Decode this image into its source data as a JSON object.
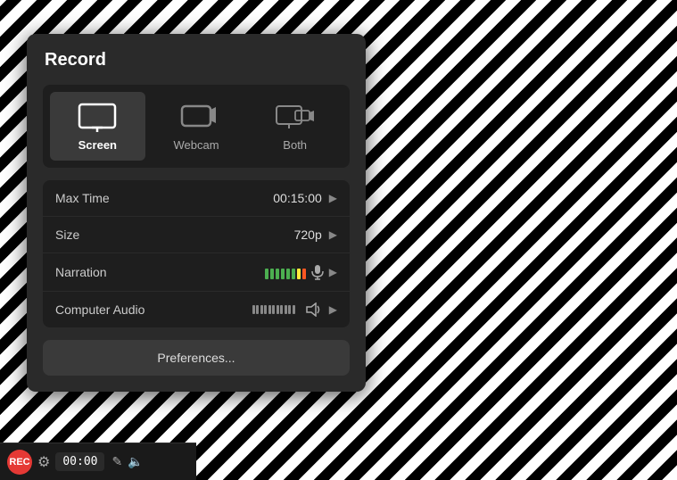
{
  "panel": {
    "title": "Record",
    "modes": [
      {
        "id": "screen",
        "label": "Screen",
        "active": true
      },
      {
        "id": "webcam",
        "label": "Webcam",
        "active": false
      },
      {
        "id": "both",
        "label": "Both",
        "active": false
      }
    ],
    "settings": [
      {
        "label": "Max Time",
        "value": "00:15:00",
        "type": "time"
      },
      {
        "label": "Size",
        "value": "720p",
        "type": "size"
      },
      {
        "label": "Narration",
        "value": "",
        "type": "narration"
      },
      {
        "label": "Computer Audio",
        "value": "",
        "type": "audio"
      }
    ],
    "preferences_btn": "Preferences..."
  },
  "bottom_bar": {
    "rec_label": "REC",
    "timer": "00:00"
  }
}
